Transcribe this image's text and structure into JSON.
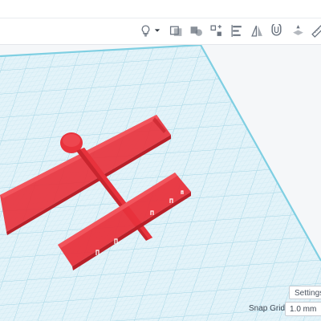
{
  "toolbar": {
    "icons": [
      "bulb-icon",
      "dropdown-arrow-icon",
      "group-icon",
      "ungroup-icon",
      "align-icon",
      "mirror-icon",
      "flip-icon",
      "magnet-icon",
      "workplane-icon",
      "ruler-icon"
    ]
  },
  "viewport": {
    "settings_label": "Settings",
    "snap_grid_label": "Snap Grid",
    "snap_grid_value": "1.0 mm"
  },
  "colors": {
    "grid_fill": "#dff1f7",
    "grid_line": "#a9d8e6",
    "grid_edge": "#7fcfe2",
    "model_red": "#e8323c",
    "model_red_dark": "#b81f28",
    "model_red_light": "#f2545c"
  }
}
